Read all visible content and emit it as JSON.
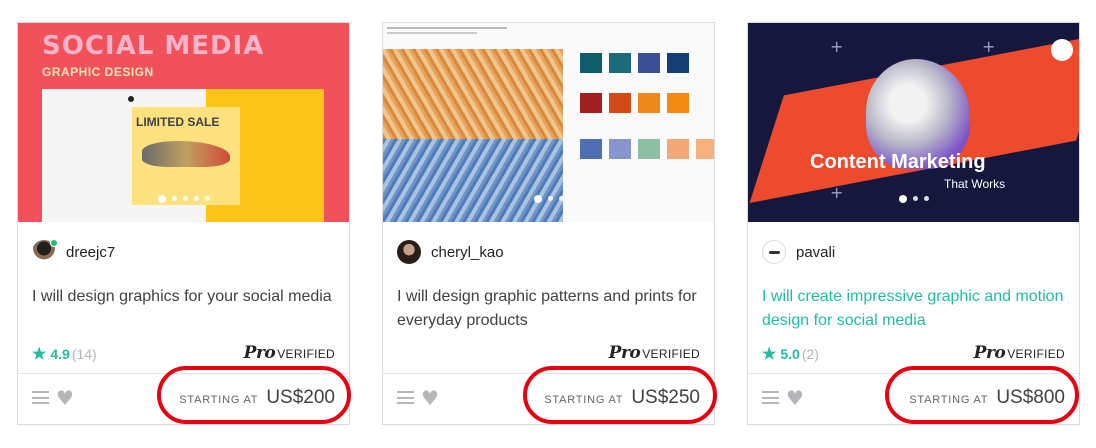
{
  "colors": {
    "accent": "#1dbfa0",
    "highlight": "#e60012",
    "border": "#dadbdd",
    "muted": "#b5b6ba"
  },
  "cards": [
    {
      "thumb": {
        "headline": "SOCIAL MEDIA",
        "subheadline": "GRAPHIC DESIGN",
        "sticker": "LIMITED SALE"
      },
      "seller": "dreejc7",
      "title": "I will design graphics for your social media",
      "rating": "4.9",
      "reviews": "(14)",
      "pro_mark": "Pro",
      "pro_label": "VERIFIED",
      "price_label": "STARTING AT",
      "price": "US$200"
    },
    {
      "thumb": {},
      "seller": "cheryl_kao",
      "title": "I will design graphic patterns and prints for everyday products",
      "pro_mark": "Pro",
      "pro_label": "VERIFIED",
      "price_label": "STARTING AT",
      "price": "US$250"
    },
    {
      "thumb": {
        "headline": "Content Marketing",
        "subheadline": "That Works"
      },
      "seller": "pavali",
      "title": "I will create impressive graphic and motion design for social media",
      "rating": "5.0",
      "reviews": "(2)",
      "pro_mark": "Pro",
      "pro_label": "VERIFIED",
      "price_label": "STARTING AT",
      "price": "US$800"
    }
  ],
  "icons": {
    "star": "star-icon",
    "menu": "menu-icon",
    "heart": "heart-icon"
  }
}
